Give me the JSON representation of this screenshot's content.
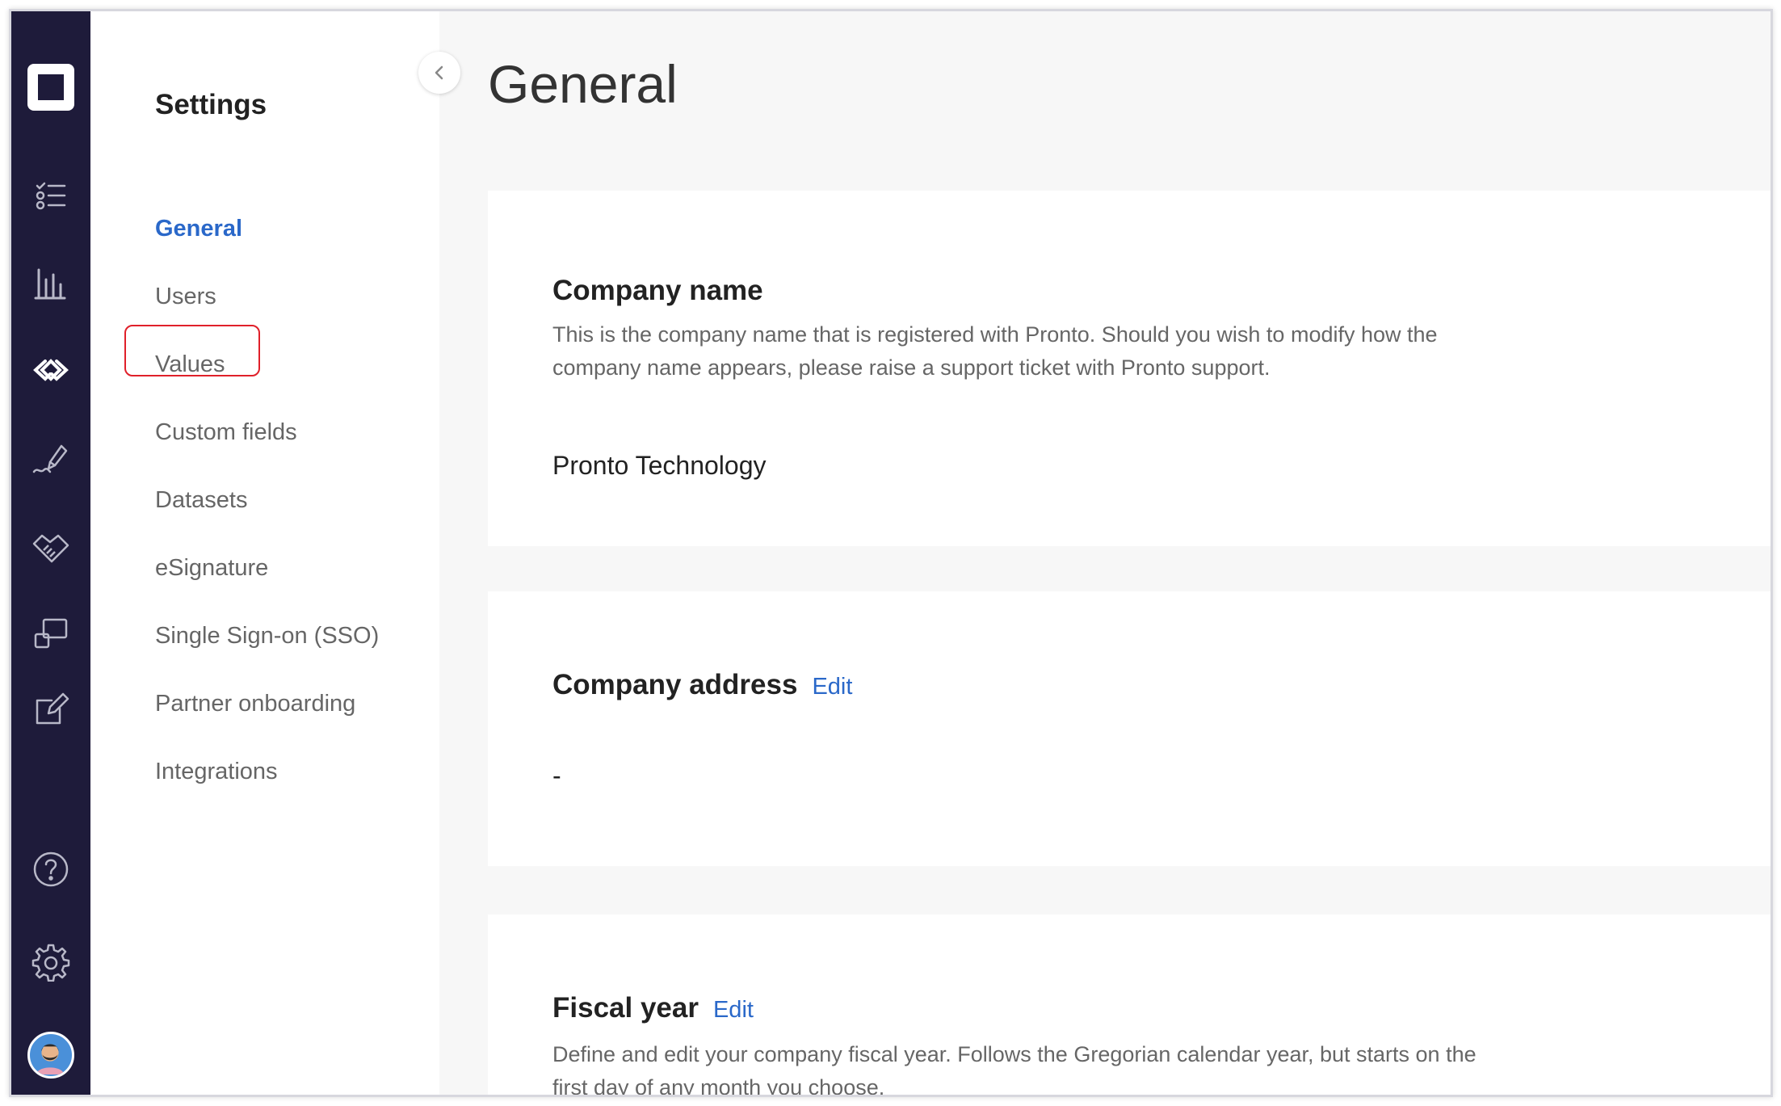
{
  "rail": {
    "icons": [
      "logo-icon",
      "checklist-icon",
      "bar-chart-icon",
      "values-icon",
      "signature-pen-icon",
      "handshake-icon",
      "devices-icon",
      "edit-icon",
      "help-icon",
      "gear-icon",
      "avatar"
    ]
  },
  "settings": {
    "title": "Settings",
    "items": [
      {
        "label": "General",
        "active": true
      },
      {
        "label": "Users"
      },
      {
        "label": "Values"
      },
      {
        "label": "Custom fields"
      },
      {
        "label": "Datasets"
      },
      {
        "label": "eSignature"
      },
      {
        "label": "Single Sign-on (SSO)"
      },
      {
        "label": "Partner onboarding"
      },
      {
        "label": "Integrations"
      }
    ]
  },
  "main": {
    "title": "General",
    "company_name": {
      "title": "Company name",
      "description": "This is the company name that is registered with Pronto. Should you wish to modify how the company name appears, please raise a support ticket with Pronto support.",
      "value": "Pronto Technology"
    },
    "company_address": {
      "title": "Company address",
      "edit_label": "Edit",
      "value": "-"
    },
    "fiscal_year": {
      "title": "Fiscal year",
      "edit_label": "Edit",
      "description": "Define and edit your company fiscal year. Follows the Gregorian calendar year, but starts on the first day of any month you choose."
    }
  },
  "colors": {
    "rail_bg": "#1e1b3a",
    "accent": "#2a68c9",
    "highlight": "#e0202a"
  }
}
